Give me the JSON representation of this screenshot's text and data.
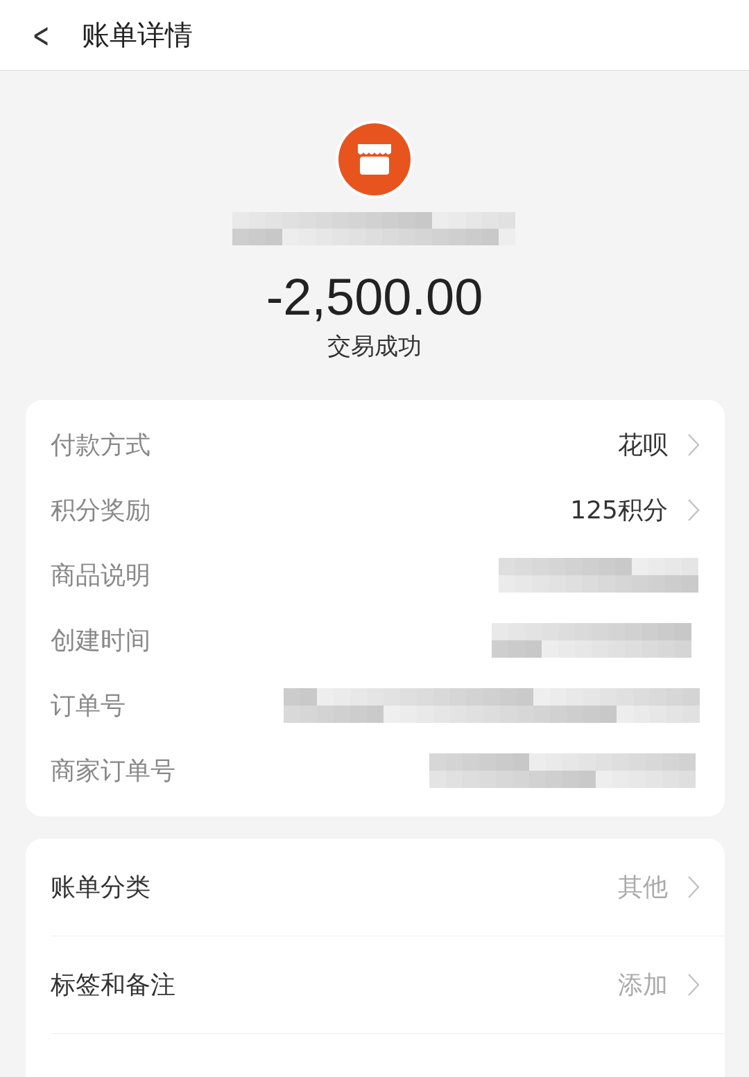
{
  "header": {
    "back": "<",
    "title": "账单详情"
  },
  "summary": {
    "merchant": {
      "kind": "redacted"
    },
    "amount": "-2,500.00",
    "status": "交易成功"
  },
  "details": [
    {
      "label": "付款方式",
      "kind": "value",
      "value": "花呗"
    },
    {
      "label": "积分奖励",
      "kind": "value",
      "value": "125积分"
    },
    {
      "label": "商品说明",
      "kind": "redacted"
    },
    {
      "label": "创建时间",
      "kind": "redacted"
    },
    {
      "label": "订单号",
      "kind": "redacted"
    },
    {
      "label": "商家订单号",
      "kind": "redacted"
    }
  ],
  "actions": [
    {
      "label": "账单分类",
      "value": "其他"
    },
    {
      "label": "标签和备注",
      "value": "添加"
    }
  ]
}
